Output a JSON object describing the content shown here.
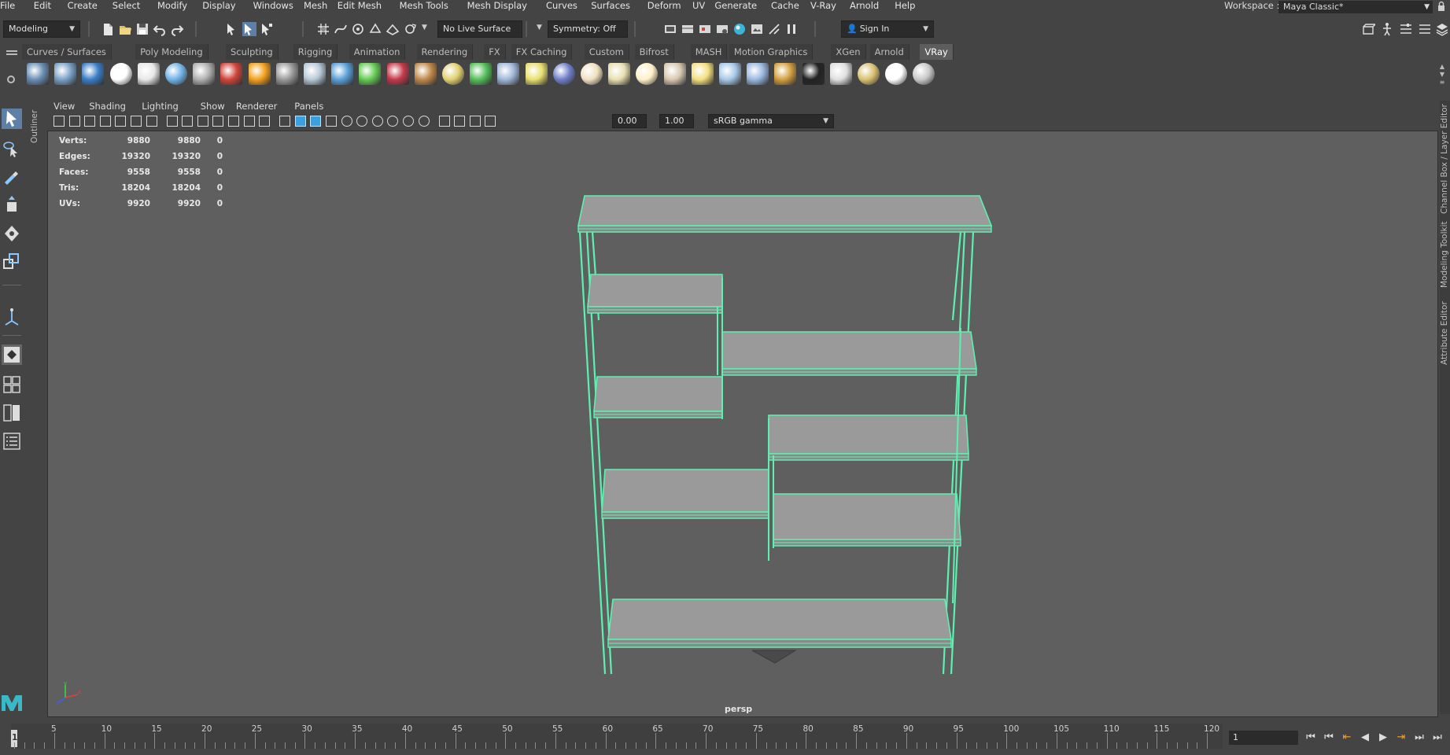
{
  "menubar": {
    "items": [
      "File",
      "Edit",
      "Create",
      "Select",
      "Modify",
      "Display",
      "Windows",
      "Mesh",
      "Edit Mesh",
      "Mesh Tools",
      "Mesh Display",
      "Curves",
      "Surfaces",
      "Deform",
      "UV",
      "Generate",
      "Cache",
      "V-Ray",
      "Arnold",
      "Help"
    ],
    "workspace_label": "Workspace :",
    "workspace_value": "Maya Classic*"
  },
  "statusline": {
    "mode": "Modeling",
    "live_surface": "No Live Surface",
    "symmetry": "Symmetry: Off",
    "sign_in": "Sign In"
  },
  "shelf": {
    "tabs": [
      "Curves / Surfaces",
      "Poly Modeling",
      "Sculpting",
      "Rigging",
      "Animation",
      "Rendering",
      "FX",
      "FX Caching",
      "Custom",
      "Bifrost",
      "MASH",
      "Motion Graphics",
      "XGen",
      "Arnold",
      "VRay"
    ],
    "active_tab": "VRay",
    "icons": [
      "vray-settings-icon",
      "vray-material-icon",
      "vray-framebuffer-icon",
      "vray-logo-icon",
      "vray-render-icon",
      "vray-sphere-icon",
      "vray-camera-icon",
      "vray-mtl-icon",
      "vray-fire-icon",
      "vray-proxy-icon",
      "vray-cube-icon",
      "vray-cone-icon",
      "vray-volume-icon",
      "vray-fur-icon",
      "vray-plane-icon",
      "vray-dome-icon",
      "vray-grass-icon",
      "vray-particle-icon",
      "vray-curve-icon",
      "vray-globe-icon",
      "vray-half-dome-icon",
      "vray-spot-icon",
      "vray-sphere-light-icon",
      "vray-ies-icon",
      "vray-sun-icon",
      "vray-rect-light-icon",
      "vray-mesh-light-icon",
      "vray-vrscene-icon",
      "vray-checker-icon",
      "vray-vfb-icon",
      "vray-lightmix-icon",
      "vray-cloud-icon",
      "help-icon"
    ],
    "icon_colors": [
      "#6a8fb5",
      "#7aa2c8",
      "#3a7ec6",
      "#ffffff",
      "#e8e8e8",
      "#6fb2e6",
      "#b0b0b0",
      "#d0453a",
      "#f2a11e",
      "#9a9a9a",
      "#b8c8d8",
      "#5aa0d8",
      "#66cc55",
      "#c43a4a",
      "#c08a4a",
      "#e0d070",
      "#55c05a",
      "#a0b8d8",
      "#e8e070",
      "#6e7ec8",
      "#f0e0c0",
      "#e8e0b0",
      "#fff0c8",
      "#d8c8b0",
      "#f4e080",
      "#a8c8e8",
      "#9ab8e0",
      "#d4a040",
      "#222222",
      "#e0e0e0",
      "#d8c070",
      "#ffffff",
      "#c8c8c8"
    ]
  },
  "panel": {
    "menus": [
      "View",
      "Shading",
      "Lighting",
      "Show",
      "Renderer",
      "Panels"
    ],
    "exposure": "0.00",
    "gamma": "1.00",
    "color_space": "sRGB gamma"
  },
  "hud": {
    "rows": [
      {
        "label": "Verts:",
        "a": "9880",
        "b": "9880",
        "c": "0"
      },
      {
        "label": "Edges:",
        "a": "19320",
        "b": "19320",
        "c": "0"
      },
      {
        "label": "Faces:",
        "a": "9558",
        "b": "9558",
        "c": "0"
      },
      {
        "label": "Tris:",
        "a": "18204",
        "b": "18204",
        "c": "0"
      },
      {
        "label": "UVs:",
        "a": "9920",
        "b": "9920",
        "c": "0"
      }
    ],
    "camera": "persp"
  },
  "outliner_tab": "Outliner",
  "right_dock_tabs": [
    "Channel Box / Layer Editor",
    "Modeling Toolkit",
    "Attribute Editor"
  ],
  "timeline": {
    "ticks": [
      "5",
      "10",
      "15",
      "20",
      "25",
      "30",
      "35",
      "40",
      "45",
      "50",
      "55",
      "60",
      "65",
      "70",
      "75",
      "80",
      "85",
      "90",
      "95",
      "100",
      "105",
      "110",
      "115",
      "120"
    ],
    "current_frame_marker": "1",
    "current_frame": "1"
  },
  "colors": {
    "wireframe_highlight": "#5ef0b0",
    "shelf_face": "#9a9a9a",
    "viewport_bg": "#5f5f5f"
  }
}
